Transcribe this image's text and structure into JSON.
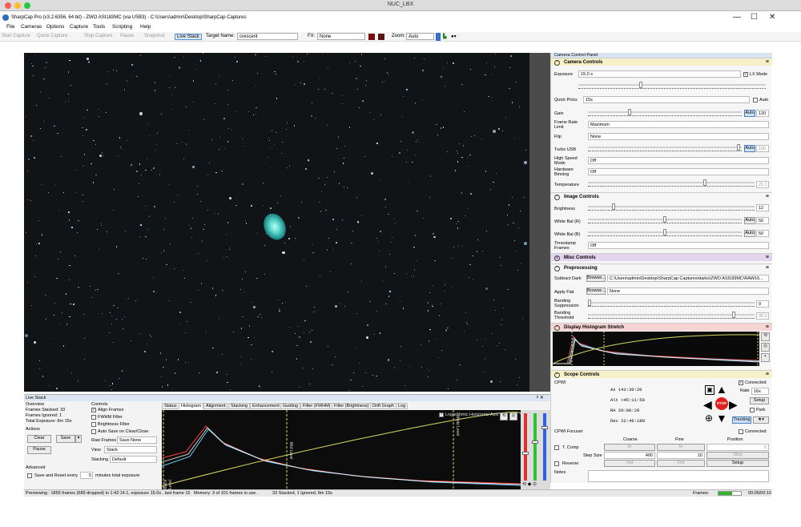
{
  "window": {
    "mac_title": "NUC_LBX",
    "app_title": "SharpCap Pro (v3.2.6356, 64 bit) - ZWO ASI183MC (via USB3) - C:\\Users\\admin\\Desktop\\SharpCap Captures",
    "controls": [
      "—",
      "☐",
      "✕"
    ]
  },
  "menu": [
    "File",
    "Cameras",
    "Options",
    "Capture",
    "Tools",
    "Scripting",
    "Help"
  ],
  "toolbar": {
    "start_capture": "Start Capture",
    "quick_capture": "Quick Capture",
    "stop_capture": "Stop Capture",
    "pause": "Pause",
    "snapshot": "Snapshot",
    "live_stack": "Live Stack",
    "target_name_label": "Target Name:",
    "target_name_value": "crescent",
    "fx_label": "FX:",
    "fx_value": "None",
    "zoom_label": "Zoom:",
    "zoom_value": "Auto"
  },
  "right_panel": {
    "header": "Camera Control Panel",
    "camera_controls": {
      "title": "Camera Controls",
      "exposure_label": "Exposure",
      "exposure_value": "15.0 s",
      "lx_mode_label": "LX Mode",
      "quick_picks_label": "Quick Picks",
      "quick_picks_value": "15s",
      "auto_label": "Auto",
      "gain_label": "Gain",
      "gain_value": "120",
      "frame_rate_label": "Frame Rate Limit",
      "frame_rate_value": "Maximum",
      "flip_label": "Flip",
      "flip_value": "None",
      "turbo_label": "Turbo USB",
      "turbo_value": "100",
      "high_speed_label": "High Speed Mode",
      "high_speed_value": "Off",
      "binning_label": "Hardware Binning",
      "binning_value": "Off",
      "temperature_label": "Temperature",
      "temperature_value": "21.1"
    },
    "image_controls": {
      "title": "Image Controls",
      "brightness_label": "Brightness",
      "brightness_value": "12",
      "wb_r_label": "White Bal (R)",
      "wb_r_value": "50",
      "wb_b_label": "White Bal (B)",
      "wb_b_value": "50",
      "timestamp_label": "Timestamp Frames",
      "timestamp_value": "Off"
    },
    "misc_controls_title": "Misc Controls",
    "preprocessing": {
      "title": "Preprocessing",
      "subtract_dark_label": "Subtract Dark",
      "browse_label": "Browse...",
      "subtract_dark_value": "C:\\Users\\admin\\Desktop\\SharpCap Captures\\darks\\ZWO ASI183MC\\RAW16...",
      "apply_flat_label": "Apply Flat",
      "apply_flat_value": "None",
      "banding_suppression_label": "Banding Suppression",
      "banding_suppression_value": "0",
      "banding_threshold_label": "Banding Threshold",
      "banding_threshold_value": "35.0"
    },
    "histogram_stretch_title": "Display Histogram Stretch",
    "scope_controls": {
      "title": "Scope Controls",
      "device": "CPWI",
      "connected_label": "Connected",
      "az": "Az  142:30:20",
      "alt": "Alt +45:11:58",
      "ra": "RA  20:00:29",
      "dec": "Dec 22:46:18N",
      "rate_label": "Rate",
      "rate_value": "16x",
      "setup_label": "Setup",
      "park_label": "Park",
      "tracking_label": "Tracking",
      "stop_label": "STOP"
    },
    "focuser": {
      "title": "CPWI Focuser",
      "connected_label": "Connected",
      "coarse_label": "Coarse",
      "fine_label": "Fine",
      "position_label": "Position",
      "in_label": "In",
      "out_label": "Out",
      "t_comp_label": "T. Comp",
      "position_value": "0",
      "step_size_label": "Step Size",
      "coarse_step": "400",
      "fine_step": "10",
      "stop_label": "Stop",
      "reverse_label": "Reverse",
      "setup_label": "Setup"
    },
    "notes_label": "Notes"
  },
  "live_stack": {
    "title": "Live Stack",
    "overview_label": "Overview",
    "frames_stacked": "Frames Stacked: 33",
    "frames_ignored": "Frames Ignored: 1",
    "total_exposure": "Total Exposure: 8m 15s",
    "actions_label": "Actions",
    "clear_label": "Clear",
    "save_label": "Save",
    "pause_label": "Pause",
    "advanced_label": "Advanced",
    "save_reset_label": "Save and Reset every",
    "save_reset_minutes": "5",
    "save_reset_suffix": "minutes total exposure",
    "controls_label": "Controls",
    "align_frames": "Align Frames",
    "fwhm_filter": "FWHM Filter",
    "brightness_filter": "Brightness Filter",
    "auto_save": "Auto Save on Clear/Close",
    "raw_frames_label": "Raw Frames",
    "raw_frames_value": "Save None",
    "view_label": "View",
    "view_value": "Stack",
    "stacking_label": "Stacking",
    "stacking_value": "Default",
    "tabs": [
      "Status",
      "Histogram",
      "Alignment",
      "Stacking",
      "Enhancement",
      "Guiding",
      "Filter (FWHM)",
      "Filter (Brightness)",
      "Drift Graph",
      "Log"
    ],
    "log_axis_label": "Logarithmic Horizontal Axis",
    "mid_level": "Mid Level",
    "white_level": "White Level",
    "black_level": "Black Level"
  },
  "status": {
    "previewing": "Previewing : 1855 frames (689 dropped) in 1:42:14.1, exposure 15.0s , last frame 15",
    "memory": "Memory: 3 of 101 frames in use.",
    "stacked": "33 Stacked, 1 Ignored, 8m 15s",
    "frames_label": "Frames:",
    "time": "00:05/00:10"
  },
  "colors": {
    "camera_controls_bg": "#f5f0c8",
    "misc_controls_bg": "#e4d4ee",
    "histogram_stretch_bg": "#f7d4d4",
    "scope_controls_bg": "#f5f0c8",
    "stop_red": "#e02020"
  }
}
